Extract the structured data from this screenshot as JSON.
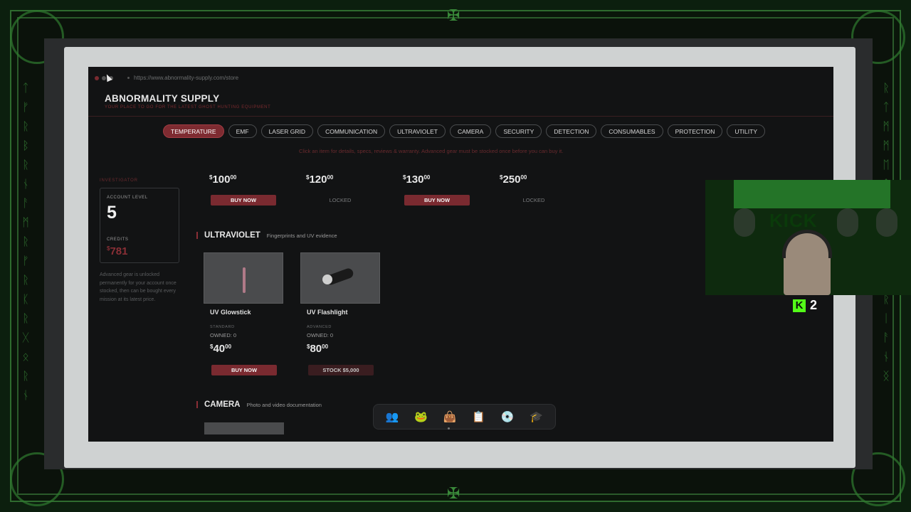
{
  "browser": {
    "url": "https://www.abnormality-supply.com/store"
  },
  "store": {
    "title": "ABNORMALITY SUPPLY",
    "tagline": "YOUR PLACE TO GO FOR THE LATEST GHOST HUNTING EQUIPMENT"
  },
  "tabs": [
    {
      "label": "TEMPERATURE",
      "active": true
    },
    {
      "label": "EMF"
    },
    {
      "label": "LASER GRID"
    },
    {
      "label": "COMMUNICATION"
    },
    {
      "label": "ULTRAVIOLET"
    },
    {
      "label": "CAMERA"
    },
    {
      "label": "SECURITY"
    },
    {
      "label": "DETECTION"
    },
    {
      "label": "CONSUMABLES"
    },
    {
      "label": "PROTECTION"
    },
    {
      "label": "UTILITY"
    }
  ],
  "notice": "Click an item for details, specs, reviews & warranty. Advanced gear must be stocked once before you can buy it.",
  "sidebar": {
    "section_label": "INVESTIGATOR",
    "account_level_label": "ACCOUNT LEVEL",
    "account_level": "5",
    "credits_label": "CREDITS",
    "credits_currency": "$",
    "credits": "781",
    "note": "Advanced gear is unlocked permanently for your account once stocked, then can be bought every mission at its latest price."
  },
  "temperature_items": [
    {
      "price_dollars": "100",
      "price_cents": "00",
      "action": "BUY NOW"
    },
    {
      "price_dollars": "120",
      "price_cents": "00",
      "action": "LOCKED"
    },
    {
      "price_dollars": "130",
      "price_cents": "00",
      "action": "BUY NOW"
    },
    {
      "price_dollars": "250",
      "price_cents": "00",
      "action": "LOCKED"
    }
  ],
  "currency_symbol": "$",
  "ultraviolet": {
    "title": "ULTRAVIOLET",
    "subtitle": "Fingerprints and UV evidence",
    "items": [
      {
        "name": "UV Glowstick",
        "tier": "STANDARD",
        "owned": "OWNED: 0",
        "price_dollars": "40",
        "price_cents": "00",
        "action": "BUY NOW"
      },
      {
        "name": "UV Flashlight",
        "tier": "ADVANCED",
        "owned": "OWNED: 0",
        "price_dollars": "80",
        "price_cents": "00",
        "action": "STOCK $5,000"
      }
    ]
  },
  "camera": {
    "title": "CAMERA",
    "subtitle": "Photo and video documentation"
  },
  "dock": {
    "icons": [
      "team-icon",
      "frog-icon",
      "shop-bag-icon",
      "clipboard-icon",
      "disc-icon",
      "graduation-cap-icon"
    ]
  },
  "webcam": {
    "sign_text": "KICK"
  },
  "stream": {
    "viewer_count": "2"
  },
  "colors": {
    "accent": "#7e2b31",
    "kick_green": "#53fc18"
  }
}
